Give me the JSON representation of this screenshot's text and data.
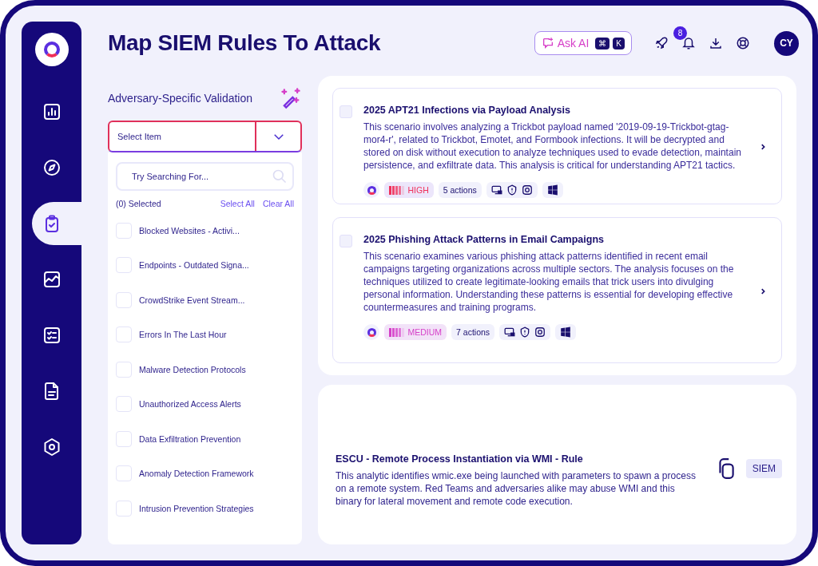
{
  "header": {
    "title": "Map SIEM Rules To Attack",
    "ask_ai": {
      "label": "Ask AI",
      "keys": [
        "⌘",
        "K"
      ]
    },
    "notification_count": "8",
    "avatar": "CY"
  },
  "sidebar": {
    "items": [
      {
        "kind": "chart",
        "selected": false
      },
      {
        "kind": "compass",
        "selected": false
      },
      {
        "kind": "clipboard",
        "selected": true
      },
      {
        "kind": "trend",
        "selected": false
      },
      {
        "kind": "checklist",
        "selected": false
      },
      {
        "kind": "document",
        "selected": false
      },
      {
        "kind": "hexagon",
        "selected": false
      }
    ]
  },
  "filter": {
    "title": "Adversary-Specific Validation",
    "dropdown": {
      "placeholder": "Select Item"
    },
    "search": {
      "placeholder": "Try Searching For..."
    },
    "selected_count": "(0) Selected",
    "select_all": "Select All",
    "clear_all": "Clear All",
    "items": [
      {
        "label": "Blocked Websites - Activi...",
        "checked": false
      },
      {
        "label": "Endpoints - Outdated Signa...",
        "checked": false
      },
      {
        "label": "CrowdStrike Event Stream...",
        "checked": false
      },
      {
        "label": "Errors In The Last Hour",
        "checked": false
      },
      {
        "label": "Malware Detection Protocols",
        "checked": false
      },
      {
        "label": "Unauthorized Access Alerts",
        "checked": false
      },
      {
        "label": "Data Exfiltration Prevention",
        "checked": false
      },
      {
        "label": "Anomaly Detection Framework",
        "checked": false
      },
      {
        "label": "Intrusion Prevention Strategies",
        "checked": false
      }
    ]
  },
  "scenarios": [
    {
      "title": "2025 APT21 Infections via Payload Analysis",
      "checked": false,
      "description": "This scenario involves analyzing a Trickbot payload named '2019-09-19-Trickbot-gtag-mor4-r', related to Trickbot, Emotet, and Formbook infections. It will be decrypted and stored on disk without execution to analyze techniques used to evade detection, maintain persistence, and exfiltrate data. This analysis is critical for understanding APT21 tactics.",
      "severity": {
        "kind": "high",
        "label": "HIGH",
        "level": 0.8
      },
      "actions": "5 actions"
    },
    {
      "title": "2025 Phishing Attack Patterns in Email Campaigns",
      "checked": false,
      "description": "This scenario examines various phishing attack patterns identified in recent email campaigns targeting organizations across multiple sectors. The analysis focuses on the techniques utilized to create legitimate-looking emails that trick users into divulging personal information. Understanding these patterns is essential for developing effective countermeasures and training programs.",
      "severity": {
        "kind": "medium",
        "label": "MEDIUM",
        "level": 0.8
      },
      "actions": "7 actions"
    }
  ],
  "rule": {
    "title": "ESCU - Remote Process Instantiation via WMI - Rule",
    "description": "This analytic identifies wmic.exe being launched with parameters to spawn a process on a remote system. Red Teams and adversaries alike may abuse WMI and this binary for lateral movement and remote code execution.",
    "tag": "SIEM"
  }
}
